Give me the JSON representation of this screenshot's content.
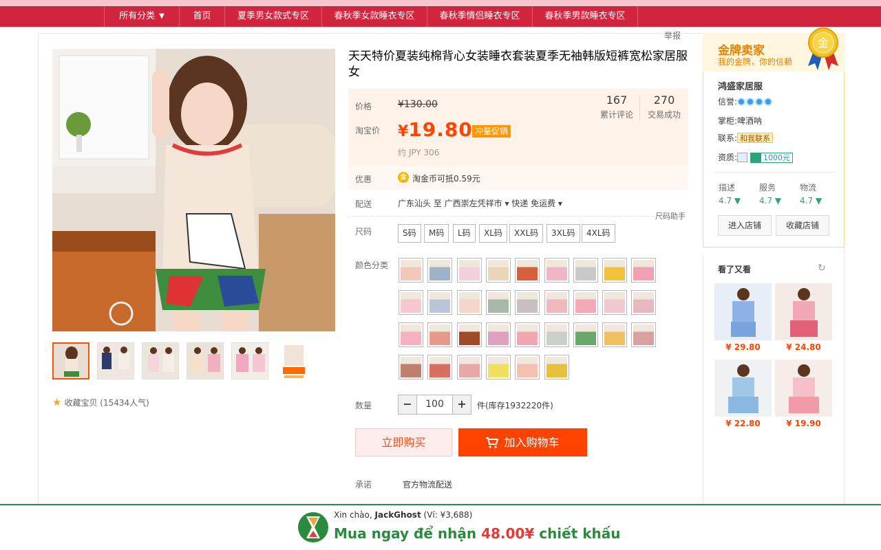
{
  "nav": {
    "items": [
      "所有分类",
      "首页",
      "夏季男女款式专区",
      "春秋季女款睡衣专区",
      "春秋季情侣睡衣专区",
      "春秋季男款睡衣专区"
    ]
  },
  "report_label": "举报",
  "product": {
    "title": "天天特价夏装纯棉背心女装睡衣套装夏季无袖韩版短裤宽松家居服女",
    "price_label": "价格",
    "original_price": "¥130.00",
    "taobao_price_label": "淘宝价",
    "currency": "¥",
    "price": "19.80",
    "promo_tag": "冲量促销",
    "jpy": "约 JPY 306",
    "reviews_count": "167",
    "reviews_label": "累计评论",
    "deals_count": "270",
    "deals_label": "交易成功",
    "discount_label": "优惠",
    "coin_text": "淘金币可抵0.59元",
    "shipping_label": "配送",
    "shipping_text": "广东汕头 至  广西崇左凭祥市 ▾   快递 免运费 ▾",
    "size_help": "尺码助手",
    "size_label": "尺码",
    "sizes": [
      "S码",
      "M码",
      "L码",
      "XL码",
      "XXL码",
      "3XL码",
      "4XL码"
    ],
    "color_label": "颜色分类",
    "quantity_label": "数量",
    "quantity": "100",
    "stock_text": "件(库存1932220件)",
    "buy_now": "立即购买",
    "add_to_cart": "加入购物车",
    "promise_label": "承诺",
    "promise_text": "官方物流配送",
    "favorite_text": "收藏宝贝 (15434人气)"
  },
  "seller": {
    "gold_title": "金牌卖家",
    "gold_sub": "我的金牌，你的信赖",
    "medal_char": "金",
    "shop_name": "鸿盛家居服",
    "credit_label": "信誉:",
    "owner_label": "掌柜:",
    "owner_name": "啤酒呐",
    "contact_label": "联系:",
    "contact_btn": "和我联系",
    "qual_label": "资质:",
    "qual_amount": "1000元",
    "scores": [
      {
        "label": "描述",
        "value": "4.7 ▼"
      },
      {
        "label": "服务",
        "value": "4.7 ▼"
      },
      {
        "label": "物流",
        "value": "4.7 ▼"
      }
    ],
    "enter_shop": "进入店铺",
    "fav_shop": "收藏店铺"
  },
  "recommend": {
    "title": "看了又看",
    "prices": [
      "¥ 29.80",
      "¥ 24.80",
      "¥ 22.80",
      "¥ 19.90"
    ]
  },
  "footer": {
    "greeting_prefix": "Xin chào, ",
    "user": "JackGhost",
    "balance": "(Ví: ¥3,688)",
    "offer_prefix": "Mua ngay để nhận ",
    "offer_amount": "48.00¥",
    "offer_suffix": " chiết khấu"
  },
  "colors": {
    "nav_red": "#d0253d",
    "price_orange": "#ff4400",
    "cart_orange": "#ff4200",
    "gold": "#e98100",
    "green": "#2b8a3e"
  }
}
